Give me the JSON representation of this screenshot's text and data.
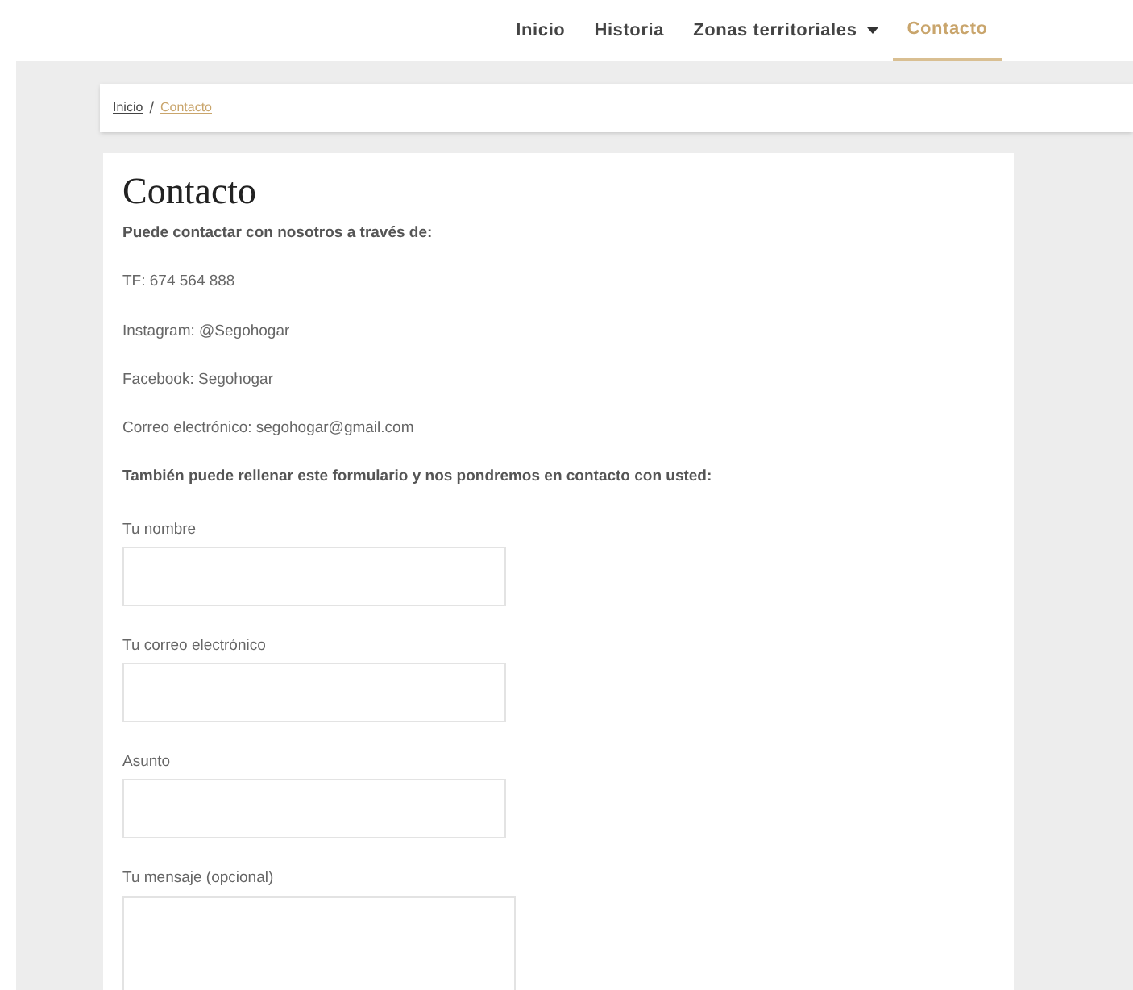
{
  "nav": [
    {
      "label": "Inicio",
      "kind": "link",
      "selected": false
    },
    {
      "label": "Historia",
      "kind": "link",
      "selected": false
    },
    {
      "label": "Zonas territoriales",
      "kind": "dropdown",
      "selected": false
    },
    {
      "label": "Contacto",
      "kind": "link",
      "selected": true
    }
  ],
  "breadcrumb": [
    {
      "label": "Inicio",
      "selected": false
    },
    {
      "label": "Contacto",
      "selected": true
    }
  ],
  "breadcrumb_separator": "/",
  "title": "Contacto",
  "intro": "Puede contactar con nosotros a través de:",
  "contact_lines": [
    "TF: 674 564 888",
    "Instagram: @Segohogar",
    "Facebook: Segohogar",
    "Correo electrónico: segohogar@gmail.com"
  ],
  "form_intro": "También puede rellenar este formulario y nos pondremos en contacto con usted:",
  "fields": [
    {
      "label": "Tu nombre",
      "kind": "text"
    },
    {
      "label": "Tu correo electrónico",
      "kind": "text"
    },
    {
      "label": "Asunto",
      "kind": "text"
    },
    {
      "label": "Tu mensaje (opcional)",
      "kind": "textarea"
    }
  ]
}
